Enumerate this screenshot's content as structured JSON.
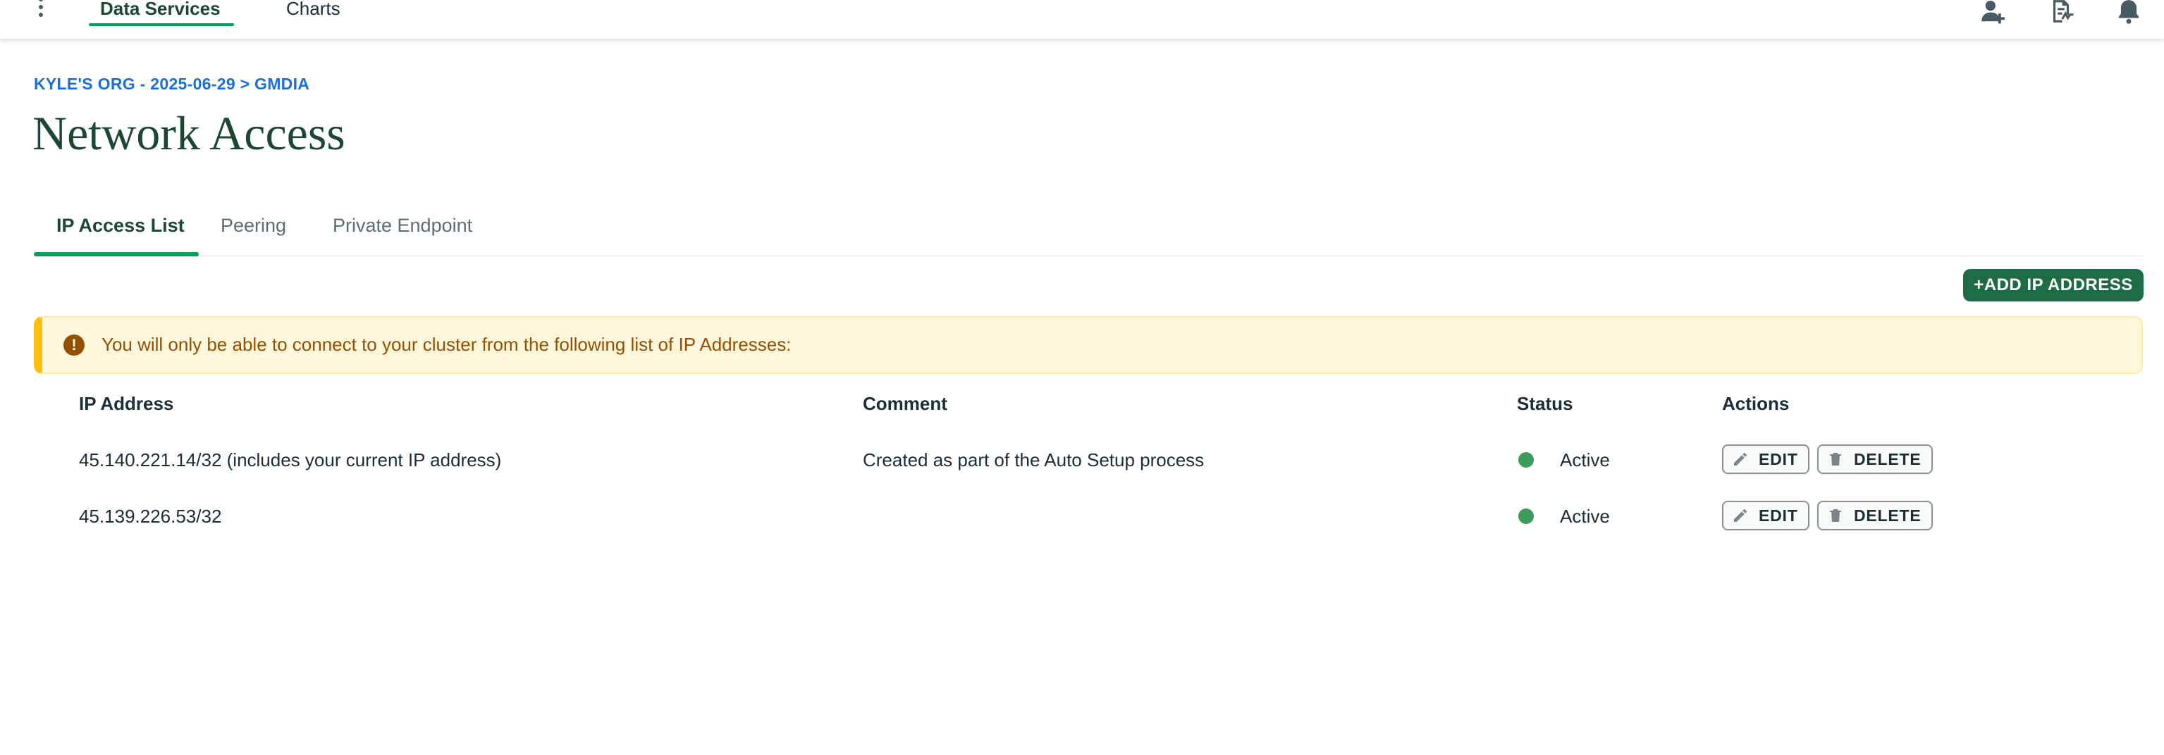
{
  "nav": {
    "tabs": [
      {
        "label": "Data Services",
        "active": true
      },
      {
        "label": "Charts",
        "active": false
      }
    ],
    "icons": [
      "person-add-icon",
      "activity-feed-icon",
      "bell-icon"
    ]
  },
  "header": {
    "breadcrumb": "KYLE'S ORG - 2025-06-29 > GMDIA",
    "title": "Network Access"
  },
  "subtabs": [
    {
      "label": "IP Access List",
      "active": true
    },
    {
      "label": "Peering",
      "active": false
    },
    {
      "label": "Private Endpoint",
      "active": false
    }
  ],
  "toolbar": {
    "add_label": "+ADD IP ADDRESS"
  },
  "banner": {
    "icon": "!",
    "text": "You will only be able to connect to your cluster from the following list of IP Addresses:"
  },
  "table": {
    "columns": [
      "IP Address",
      "Comment",
      "Status",
      "Actions"
    ],
    "rows": [
      {
        "ip": "45.140.221.14/32 (includes your current IP address)",
        "comment": "Created as part of the Auto Setup process",
        "status": "Active"
      },
      {
        "ip": "45.139.226.53/32",
        "comment": "",
        "status": "Active"
      }
    ],
    "actions": {
      "edit": "EDIT",
      "delete": "DELETE"
    }
  },
  "colors": {
    "brand_green": "#1e6b47",
    "tab_underline": "#00a35c",
    "link_blue": "#1a6fd8",
    "warning_bg": "#fef7db",
    "warning_text": "#944f01",
    "status_active": "#3d9c5a"
  }
}
